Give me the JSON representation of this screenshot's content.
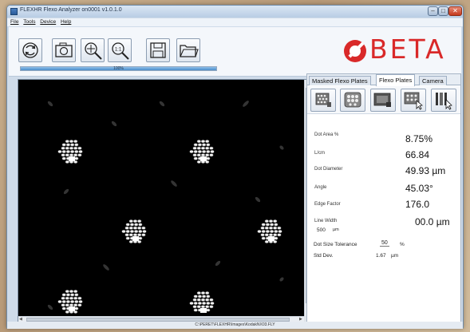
{
  "window": {
    "title": "FLEXHR Flexo Analyzer on0001 v1.0.1.0",
    "min_glyph": "–",
    "max_glyph": "□",
    "close_glyph": "✕"
  },
  "menu": {
    "file": "File",
    "tools": "Tools",
    "device": "Device",
    "help": "Help"
  },
  "toolbar": {
    "buttons": [
      {
        "name": "refresh-icon"
      },
      {
        "name": "camera-icon"
      },
      {
        "name": "zoom-fit-icon"
      },
      {
        "name": "zoom-actual-icon"
      },
      {
        "name": "save-icon"
      },
      {
        "name": "open-folder-icon"
      }
    ],
    "zoom_one_label": "1:1",
    "progress_label": "100%",
    "progress_value": 1.0
  },
  "logo": {
    "text": "BETA",
    "color": "#d92929"
  },
  "tabs": {
    "masked": "Masked Flexo Plates",
    "flexo": "Flexo Plates",
    "camera": "Camera",
    "active": "flexo"
  },
  "measurements": {
    "dot_area": {
      "label": "Dot Area %",
      "value": "8.75%"
    },
    "lpcm": {
      "label": "L/cm",
      "value": "66.84"
    },
    "dot_diameter": {
      "label": "Dot Diameter",
      "value": "49.93 µm"
    },
    "angle": {
      "label": "Angle",
      "value": "45.03°"
    },
    "edge_factor": {
      "label": "Edge Factor",
      "value": "176.0"
    },
    "line_width": {
      "label": "Line Width",
      "sub_value": "500",
      "sub_unit": "µm",
      "value": "00.0 µm"
    }
  },
  "tolerance": {
    "label": "Dot Size Tolerance",
    "value": "50",
    "unit": "%"
  },
  "std_dev": {
    "label": "Std Dev.",
    "value": "1.67",
    "unit": "µm"
  },
  "status": {
    "path": "C:\\PERET\\FLEXHR\\Images\\KodakNX03.FLY"
  }
}
